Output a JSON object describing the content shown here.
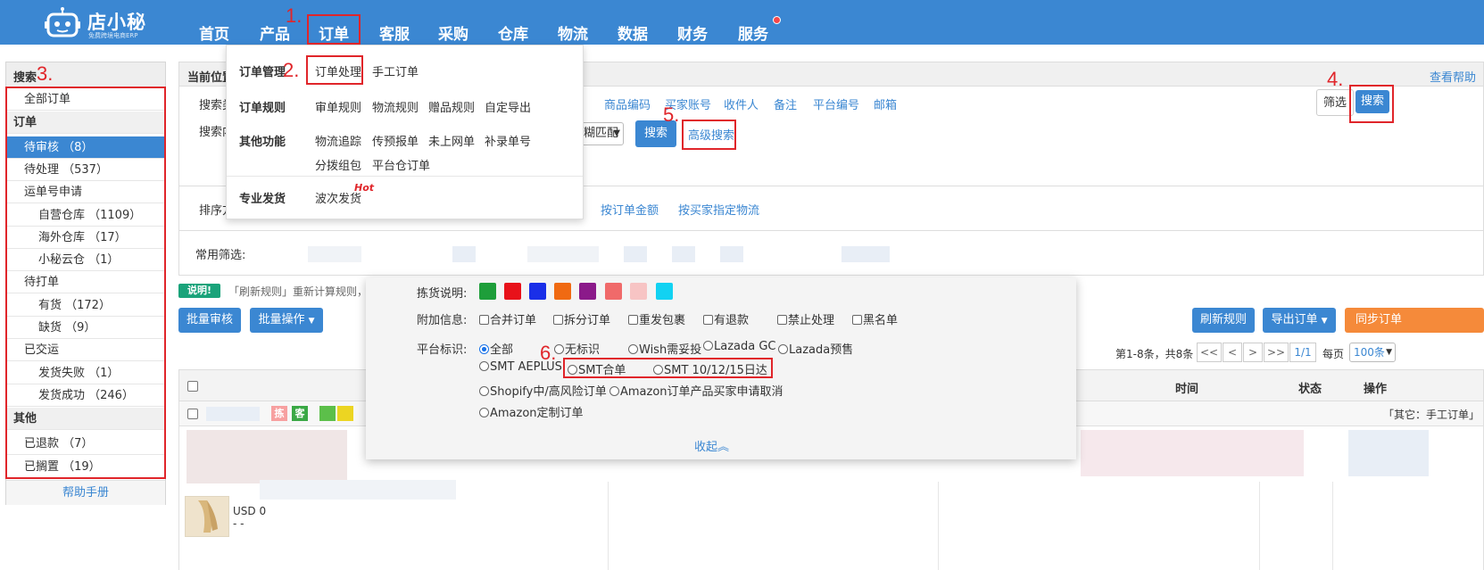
{
  "header": {
    "brand": "店小秘",
    "slogan": "免费跨境电商ERP",
    "nav": [
      "首页",
      "产品",
      "订单",
      "客服",
      "采购",
      "仓库",
      "物流",
      "数据",
      "财务",
      "服务"
    ]
  },
  "annotations": [
    "1.",
    "2.",
    "3.",
    "4.",
    "5.",
    "6."
  ],
  "order_menu": {
    "groups": [
      {
        "title": "订单管理",
        "items": [
          "订单处理",
          "手工订单"
        ]
      },
      {
        "title": "订单规则",
        "items": [
          "审单规则",
          "物流规则",
          "赠品规则",
          "自定导出"
        ]
      },
      {
        "title": "其他功能",
        "items": [
          "物流追踪",
          "传预报单",
          "未上网单",
          "补录单号",
          "分拨组包",
          "平台仓订单"
        ]
      },
      {
        "title": "专业发货",
        "items": [
          "波次发货"
        ]
      }
    ],
    "hot": "Hot"
  },
  "sidebar": {
    "search": "搜索",
    "all_orders": "全部订单",
    "group_order": "订单",
    "items": [
      "待审核 （8）",
      "待处理 （537）",
      "运单号申请",
      "自营仓库 （1109）",
      "海外仓库 （17）",
      "小秘云仓 （1）",
      "待打单",
      "有货 （172）",
      "缺货 （9）",
      "已交运",
      "发货失败 （1）",
      "发货成功 （246）"
    ],
    "group_other": "其他",
    "other_items": [
      "已退款 （7）",
      "已搁置 （19）"
    ],
    "help": "帮助手册"
  },
  "main": {
    "breadcrumb": "当前位置",
    "view_help": "查看帮助",
    "search_type_label": "搜索类",
    "search_content_label": "搜索内",
    "search_fields": [
      "商品编码",
      "买家账号",
      "收件人",
      "备注",
      "平台编号",
      "邮箱"
    ],
    "match_select": "糊匹配",
    "search_button": "搜索",
    "advanced_search": "高级搜索",
    "filter_button": "筛选",
    "top_search_button": "搜索",
    "sort_label": "排序方",
    "sort_options": [
      "按订单金额",
      "按买家指定物流"
    ],
    "common_filter": "常用筛选:",
    "notice_badge": "说明!",
    "notice_text": "「刷新规则」重新计算规则，并",
    "batch_review": "批量审核",
    "batch_ops": "批量操作",
    "refresh_rules": "刷新规则",
    "export_orders": "导出订单",
    "sync_orders": "同步订单",
    "pager_summary": "第1-8条，共8条",
    "pager_buttons": [
      "<<",
      "<",
      ">",
      ">>"
    ],
    "pager_current": "1/1",
    "per_page_label": "每页",
    "per_page": "100条",
    "col_time": "时间",
    "col_status": "状态",
    "col_ops": "操作",
    "row_tag_pick": "拣",
    "row_tag_guest": "客",
    "row_note": "「其它：手工订单」",
    "row_price": "USD 0",
    "row_dash": "- -"
  },
  "advanced": {
    "pick_label": "拣货说明:",
    "pick_colors": [
      "#1e9e3a",
      "#e8121a",
      "#1a2fe8",
      "#f06a12",
      "#8b1a8a",
      "#f06a6a",
      "#f7c4c4",
      "#12d2f2"
    ],
    "extra_label": "附加信息:",
    "extra_options": [
      "合并订单",
      "拆分订单",
      "重发包裹",
      "有退款",
      "禁止处理",
      "黑名单"
    ],
    "platform_label": "平台标识:",
    "platform_row1": [
      "全部",
      "无标识",
      "Wish需妥投",
      "Lazada GC",
      "Lazada预售"
    ],
    "platform_row2": [
      "SMT AEPLUS",
      "SMT合单",
      "SMT 10/12/15日达"
    ],
    "platform_row3": [
      "Shopify中/高风险订单",
      "Amazon订单产品买家申请取消"
    ],
    "platform_row4": [
      "Amazon定制订单"
    ],
    "collapse": "收起︽"
  }
}
